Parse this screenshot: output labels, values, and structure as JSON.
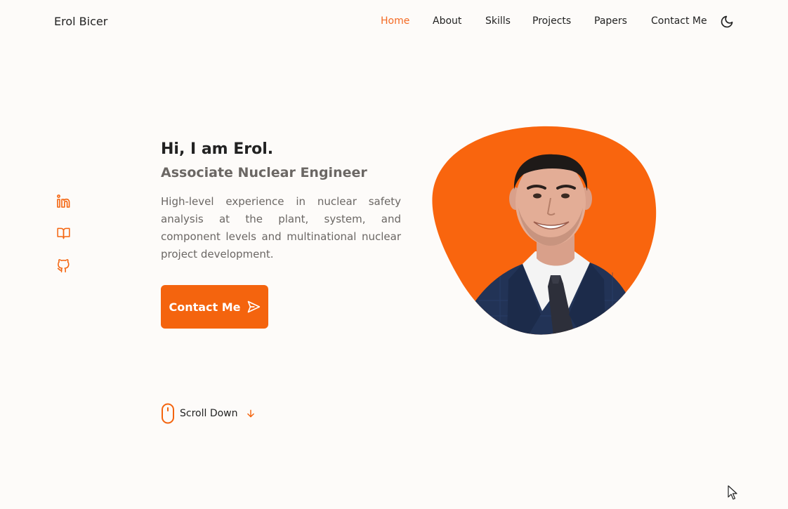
{
  "header": {
    "brand": "Erol Bicer",
    "nav": [
      {
        "label": "Home",
        "active": true
      },
      {
        "label": "About"
      },
      {
        "label": "Skills"
      },
      {
        "label": "Projects"
      },
      {
        "label": "Papers"
      },
      {
        "label": "Contact Me"
      }
    ],
    "theme_toggle_icon": "moon-icon"
  },
  "social": [
    {
      "icon": "linkedin-icon"
    },
    {
      "icon": "book-open-icon"
    },
    {
      "icon": "github-icon"
    }
  ],
  "hero": {
    "title": "Hi, I am Erol.",
    "subtitle": "Associate Nuclear Engineer",
    "description": "High-level experience in nuclear safety analysis at the plant, system, and component levels and multinational nuclear project development.",
    "cta_label": "Contact Me",
    "cta_icon": "send-icon",
    "portrait": "profile-photo"
  },
  "scroll": {
    "label": "Scroll Down",
    "icon": "mouse-icon",
    "arrow_icon": "arrow-down-icon"
  },
  "colors": {
    "accent": "#f4640e",
    "background": "#fdfbf9",
    "text": "#222222",
    "muted": "#6b6764"
  }
}
